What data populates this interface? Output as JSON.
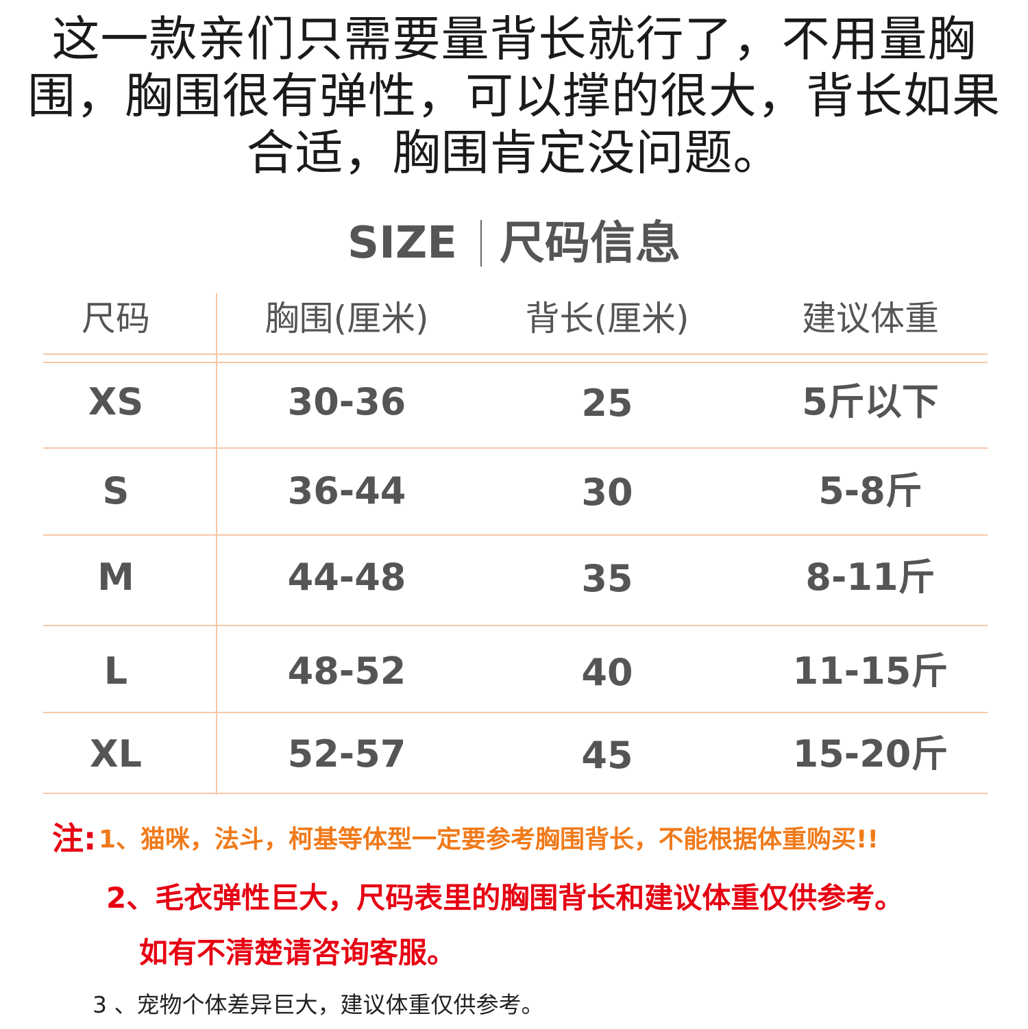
{
  "intro": {
    "line1": "这一款亲们只需要量背长就行了，不用量胸",
    "line2": "围，胸围很有弹性，可以撑的很大，背长如果",
    "line3": "合适，胸围肯定没问题。"
  },
  "size_heading": {
    "en": "SIZE",
    "zh": "尺码信息"
  },
  "table": {
    "headers": [
      "尺码",
      "胸围(厘米)",
      "背长(厘米)",
      "建议体重"
    ],
    "rows": [
      [
        "XS",
        "30-36",
        "25",
        "5斤以下"
      ],
      [
        "S",
        "36-44",
        "30",
        "5-8斤"
      ],
      [
        "M",
        "44-48",
        "35",
        "8-11斤"
      ],
      [
        "L",
        "48-52",
        "40",
        "11-15斤"
      ],
      [
        "XL",
        "52-57",
        "45",
        "15-20斤"
      ]
    ]
  },
  "notes": {
    "label": "注:",
    "note1": "1、猫咪，法斗，柯基等体型一定要参考胸围背长，不能根据体重购买!!",
    "note2": "2、毛衣弹性巨大，尺码表里的胸围背长和建议体重仅供参考。",
    "note2_cont": "如有不清楚请咨询客服。",
    "note3": "3 、宠物个体差异巨大，建议体重仅供参考。"
  },
  "colors": {
    "table_line": "#f6c7a6",
    "note_red": "#e60012",
    "note_orange": "#f07a1a",
    "text_gray": "#555555"
  }
}
